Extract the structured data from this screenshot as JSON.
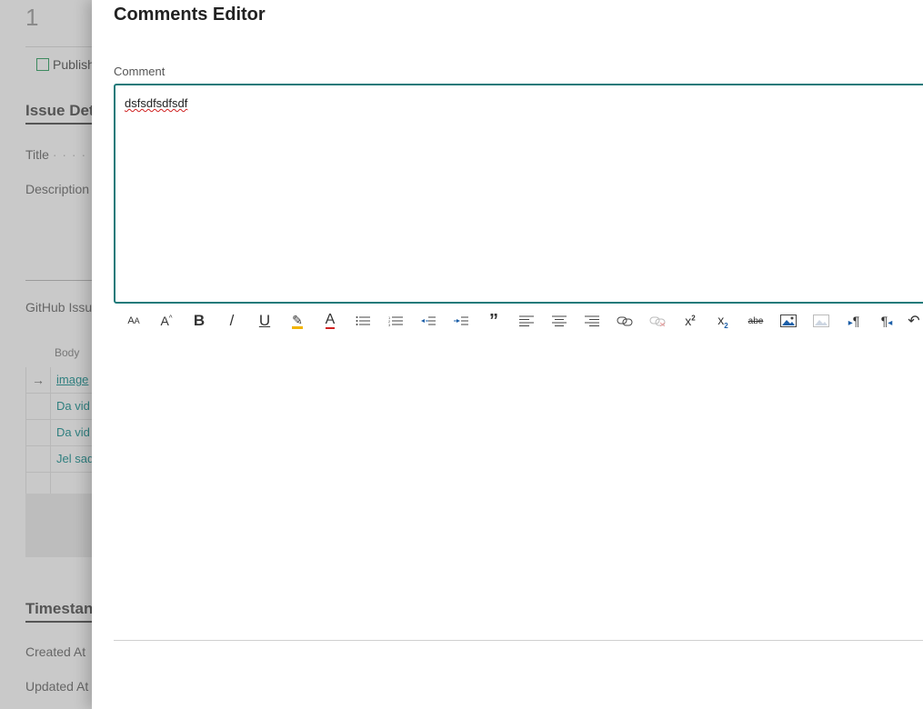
{
  "background": {
    "record_number": "1",
    "publish_label": "Publish",
    "section_issue": "Issue Det",
    "title_label": "Title",
    "title_dots": "· · · · · ·",
    "description_label": "Description",
    "github_label": "GitHub Issue",
    "grid_header": "Body",
    "grid_rows": [
      "image",
      "Da vid",
      "Da vid",
      "Jel sad",
      ""
    ],
    "section_timestamps": "Timestan",
    "created_label": "Created At",
    "updated_label": "Updated At"
  },
  "panel": {
    "title": "Comments Editor",
    "field_label": "Comment",
    "editor_text": "dsfsdfsdfsdf"
  },
  "toolbar": [
    {
      "name": "font-size-icon",
      "glyph": "Aᴀ",
      "disabled": false
    },
    {
      "name": "font-grow-icon",
      "glyph": "Aˆ",
      "disabled": false
    },
    {
      "name": "bold-icon",
      "glyph": "B",
      "disabled": false
    },
    {
      "name": "italic-icon",
      "glyph": "/",
      "disabled": false
    },
    {
      "name": "underline-icon",
      "glyph": "U",
      "disabled": false
    },
    {
      "name": "highlight-icon",
      "glyph": "✎",
      "disabled": false
    },
    {
      "name": "font-color-icon",
      "glyph": "A",
      "disabled": false
    },
    {
      "name": "bullet-list-icon",
      "glyph": "≡",
      "disabled": false
    },
    {
      "name": "numbered-list-icon",
      "glyph": "≣",
      "disabled": false
    },
    {
      "name": "outdent-icon",
      "glyph": "⇤",
      "disabled": false
    },
    {
      "name": "indent-icon",
      "glyph": "⇥",
      "disabled": false
    },
    {
      "name": "quote-icon",
      "glyph": "”",
      "disabled": false
    },
    {
      "name": "align-left-icon",
      "glyph": "☰",
      "disabled": false
    },
    {
      "name": "align-center-icon",
      "glyph": "☰",
      "disabled": false
    },
    {
      "name": "align-right-icon",
      "glyph": "☰",
      "disabled": false
    },
    {
      "name": "link-icon",
      "glyph": "∞",
      "disabled": false
    },
    {
      "name": "unlink-icon",
      "glyph": "∞",
      "disabled": true
    },
    {
      "name": "superscript-icon",
      "glyph": "x²",
      "disabled": false
    },
    {
      "name": "subscript-icon",
      "glyph": "x₂",
      "disabled": false
    },
    {
      "name": "strikethrough-icon",
      "glyph": "abc",
      "disabled": false
    },
    {
      "name": "insert-image-icon",
      "glyph": "▣",
      "disabled": false
    },
    {
      "name": "edit-image-icon",
      "glyph": "▣",
      "disabled": true
    },
    {
      "name": "ltr-icon",
      "glyph": "▸¶",
      "disabled": false
    },
    {
      "name": "rtl-icon",
      "glyph": "¶◂",
      "disabled": false
    },
    {
      "name": "undo-icon",
      "glyph": "↶",
      "disabled": false
    }
  ],
  "colors": {
    "accent": "#1d7a7a",
    "link": "#2f7f7f",
    "highlight_underline": "#f2b400",
    "font_color_underline": "#d02020"
  }
}
